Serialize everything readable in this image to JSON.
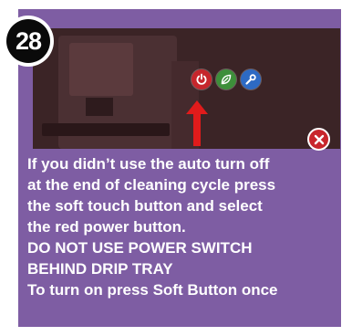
{
  "step": {
    "number": "28"
  },
  "controls": [
    {
      "name": "power",
      "icon": "power-icon",
      "color": "#c6262c"
    },
    {
      "name": "eco",
      "icon": "leaf-icon",
      "color": "#3d8f3a"
    },
    {
      "name": "service",
      "icon": "wrench-icon",
      "color": "#2d6ac4"
    }
  ],
  "close": {
    "icon": "close-icon",
    "color": "#c8262c"
  },
  "colors": {
    "panel_bg": "#7e5da3",
    "photo_bg": "#3b2426",
    "arrow": "#e01b1b",
    "text": "#ffffff"
  },
  "instructions": {
    "lines": [
      "If you didn’t use the auto turn off",
      "at the end of cleaning cycle press",
      "the soft touch button and select",
      "the red power button.",
      "DO NOT USE POWER SWITCH",
      "BEHIND DRIP TRAY",
      "To turn on press Soft Button once"
    ]
  }
}
